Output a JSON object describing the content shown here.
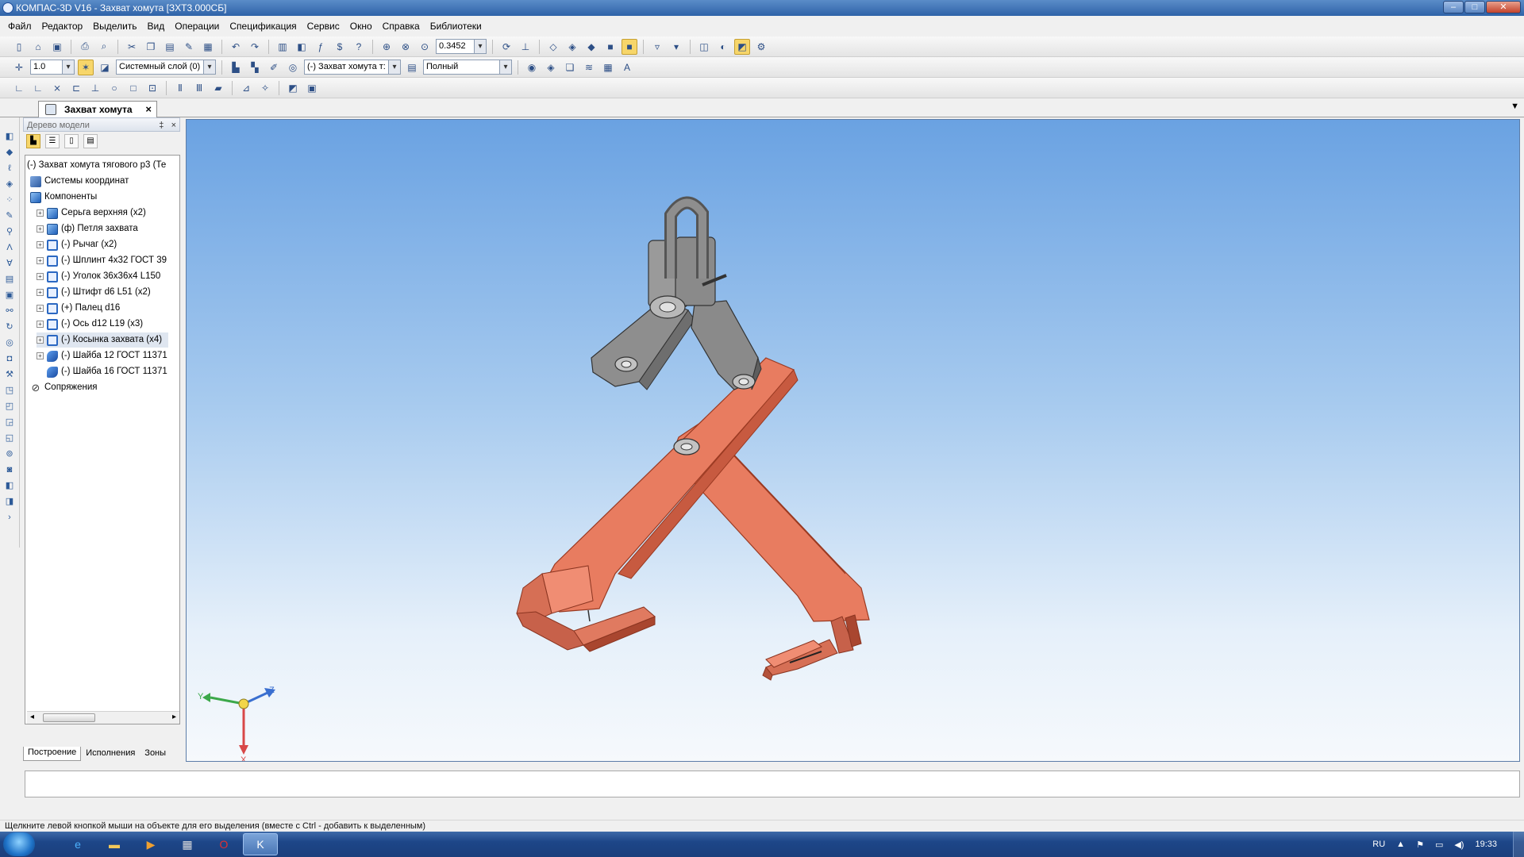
{
  "window": {
    "title": "КОМПАС-3D V16  - Захват хомута [ЗХТ3.000СБ]",
    "buttons": [
      "–",
      "□",
      "✕"
    ]
  },
  "menu": [
    "Файл",
    "Редактор",
    "Выделить",
    "Вид",
    "Операции",
    "Спецификация",
    "Сервис",
    "Окно",
    "Справка",
    "Библиотеки"
  ],
  "toolbar1": {
    "zoom_value": "0.3452"
  },
  "toolbar2": {
    "step_value": "1.0",
    "layer_value": "Системный слой (0)",
    "component_value": "(-) Захват хомута т:",
    "display_mode": "Полный"
  },
  "document": {
    "tab_title": "Захват хомута"
  },
  "tree": {
    "header": "Дерево модели",
    "pin_label": "‡",
    "close_label": "×",
    "rows": [
      {
        "label": "(-) Захват хомута тягового р3 (Те"
      },
      {
        "label": "Системы координат"
      },
      {
        "label": "Компоненты"
      },
      {
        "label": "Серьга верхняя (x2)"
      },
      {
        "label": "(ф) Петля захвата"
      },
      {
        "label": "(-) Рычаг (x2)"
      },
      {
        "label": "(-) Шплинт 4x32 ГОСТ 39"
      },
      {
        "label": "(-) Уголок 36x36x4   L150"
      },
      {
        "label": "(-) Штифт d6  L51 (x2)"
      },
      {
        "label": "(+) Палец d16"
      },
      {
        "label": "(-) Ось d12  L19 (x3)"
      },
      {
        "label": "(-) Косынка захвата (x4)"
      },
      {
        "label": "(-) Шайба 12 ГОСТ 11371"
      },
      {
        "label": "(-) Шайба 16 ГОСТ 11371"
      },
      {
        "label": "Сопряжения"
      }
    ],
    "bottom_tabs": [
      "Построение",
      "Исполнения",
      "Зоны"
    ]
  },
  "axes": {
    "x": "X",
    "y": "Y",
    "z": "Z"
  },
  "colors": {
    "lever": "#e87c60",
    "lever_edge": "#9a3a22",
    "metal": "#8e8e8e",
    "metal_edge": "#333333",
    "viewport_top": "#6aa2e2"
  },
  "statusbar": {
    "hint": "Щелкните левой кнопкой мыши на объекте для его выделения (вместе с Ctrl - добавить к выделенным)"
  },
  "taskbar": {
    "language": "RU",
    "time": "19:33"
  }
}
